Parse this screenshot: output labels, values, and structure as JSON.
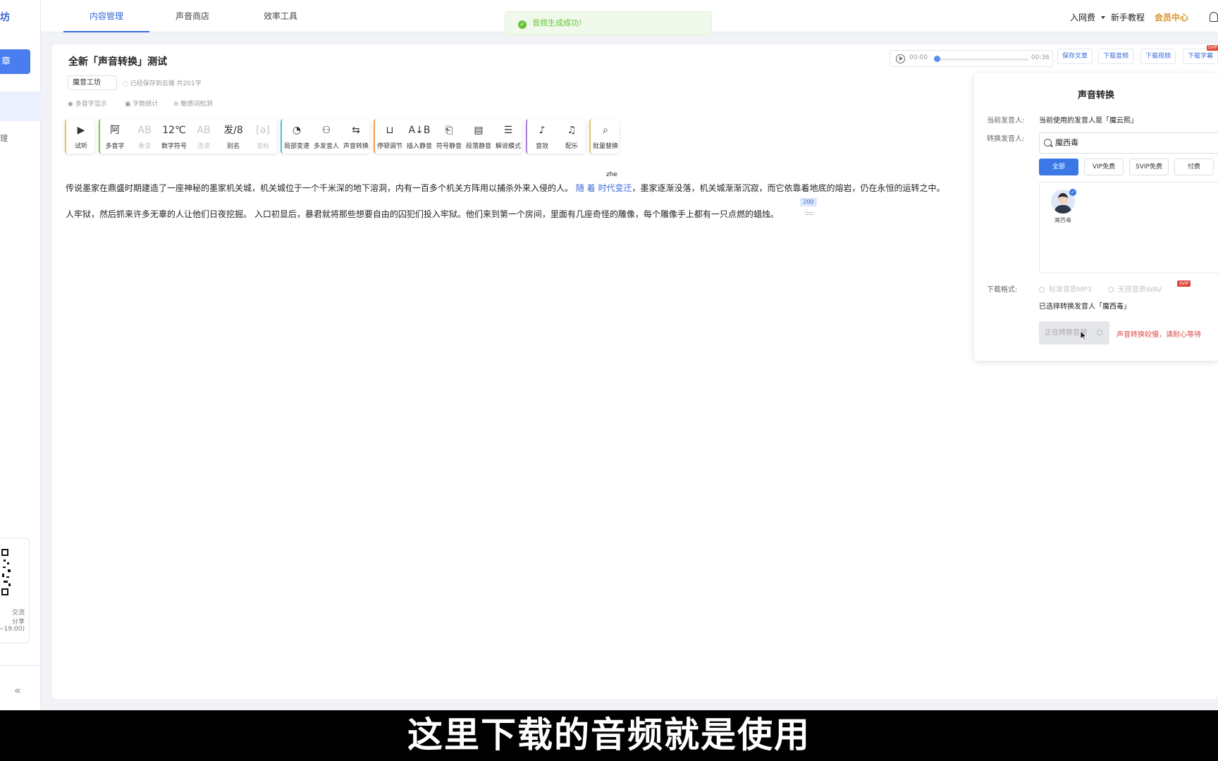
{
  "sidebar": {
    "logo": "坊",
    "new_button": "章",
    "nav_item": "理",
    "qr_lines": [
      "交流",
      "分享",
      "~19:00)"
    ],
    "collapse": "«"
  },
  "topnav": {
    "tabs": [
      {
        "label": "内容管理",
        "active": true
      },
      {
        "label": "声音商店",
        "active": false
      },
      {
        "label": "效率工具",
        "active": false
      }
    ],
    "join_group": "入网费",
    "tutorial": "新手教程",
    "vip_center": "会员中心"
  },
  "toast": {
    "message": "音频生成成功!"
  },
  "document": {
    "title": "全新「声音转换」测试",
    "author": "魔音工坊",
    "save_status": "已经保存到云端 共201字",
    "options": [
      "多音字显示",
      "字数统计",
      "敏感词检测"
    ]
  },
  "player": {
    "current": "00:00",
    "total": "00:36",
    "progress": 0
  },
  "header_buttons": [
    "保存文章",
    "下载音频",
    "下载视频",
    "下载字幕"
  ],
  "svip_tag": "SVIP",
  "toolbar": {
    "groups": [
      {
        "color": "#e9c46a",
        "tools": [
          {
            "icon": "▶",
            "label": "试听",
            "enabled": true
          }
        ]
      },
      {
        "color": "#8bc34a",
        "tools": [
          {
            "icon": "阿",
            "label": "多音字",
            "enabled": true
          },
          {
            "icon": "AB",
            "label": "重读",
            "enabled": false
          },
          {
            "icon": "12℃",
            "label": "数字符号",
            "enabled": true
          },
          {
            "icon": "AB",
            "label": "连读",
            "enabled": false
          },
          {
            "icon": "发/8",
            "label": "别名",
            "enabled": true
          },
          {
            "icon": "[ə]",
            "label": "音标",
            "enabled": false
          }
        ]
      },
      {
        "color": "#4fc3c8",
        "tools": [
          {
            "icon": "◔",
            "label": "局部变速",
            "enabled": true
          },
          {
            "icon": "⚇",
            "label": "多发音人",
            "enabled": true
          },
          {
            "icon": "⇆",
            "label": "声音转换",
            "enabled": true
          }
        ]
      },
      {
        "color": "#f0a05a",
        "tools": [
          {
            "icon": "⊔",
            "label": "停顿调节",
            "enabled": true
          },
          {
            "icon": "A↓B",
            "label": "插入静音",
            "enabled": true
          },
          {
            "icon": "⎗",
            "label": "符号静音",
            "enabled": true
          },
          {
            "icon": "▤",
            "label": "段落静音",
            "enabled": true
          },
          {
            "icon": "☰",
            "label": "解说模式",
            "enabled": true
          }
        ]
      },
      {
        "color": "#b07ee0",
        "tools": [
          {
            "icon": "♪",
            "label": "音效",
            "enabled": true
          },
          {
            "icon": "♫",
            "label": "配乐",
            "enabled": true
          }
        ]
      },
      {
        "color": "#e9c46a",
        "tools": [
          {
            "icon": "⌕",
            "label": "批量替换",
            "enabled": true
          }
        ]
      }
    ]
  },
  "content": {
    "line1_before": "传说墨家在鼎盛时期建造了一座神秘的墨家机关城，机关城位于一个千米深的地下溶洞，内有一百多个机关方阵用以捕杀外来入侵的人。",
    "line1_highlight": "随 着 时代变迁",
    "line1_after": "，墨家逐渐没落，机关城渐渐沉寂，而它依靠着地底的熔岩，仍在永恒的运转之中。",
    "pinyin": "zhe",
    "line2": "人牢狱，然后抓来许多无辜的人让他们日夜挖掘。 入口初显后，暴君就将那些想要自由的囚犯们投入牢狱。他们来到第一个房间，里面有几座奇怪的雕像，每个雕像手上都有一只点燃的蜡烛。",
    "pause_value": "200"
  },
  "panel": {
    "title": "声音转换",
    "current_label": "当前发音人:",
    "current_value": "当前使用的发音人是「魔云熙」",
    "convert_label": "转换发音人:",
    "search_value": "魔西毒",
    "filters": [
      {
        "label": "全部",
        "active": true
      },
      {
        "label": "VIP免费",
        "active": false
      },
      {
        "label": "SVIP免费",
        "active": false
      },
      {
        "label": "付费",
        "active": false
      }
    ],
    "voice_name": "魔西毒",
    "format_label": "下载格式:",
    "format_options": [
      "标准音质MP3",
      "无损音质WAV"
    ],
    "svip": "SVIP",
    "selected_info": "已选择转换发音人「魔西毒」",
    "convert_button": "正在转换音频",
    "warning": "声音转换较慢，请耐心等待"
  },
  "subtitle": "这里下载的音频就是使用"
}
